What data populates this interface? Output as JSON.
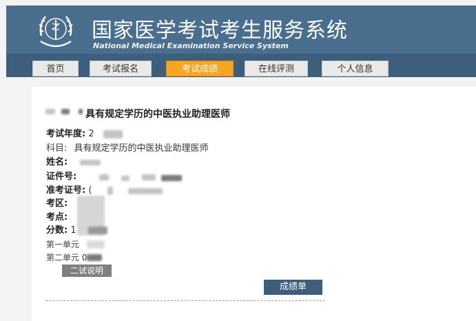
{
  "header": {
    "title_cn": "国家医学考试考生服务系统",
    "title_en": "National Medical Examination Service System"
  },
  "nav": {
    "items": [
      {
        "label": "首页"
      },
      {
        "label": "考试报名"
      },
      {
        "label": "考试成绩"
      },
      {
        "label": "在线评测"
      },
      {
        "label": "个人信息"
      }
    ],
    "active": "考试成绩"
  },
  "result": {
    "title": "具有规定学历的中医执业助理医师",
    "fields": {
      "year": {
        "label": "考试年度:",
        "value": "2"
      },
      "subject": {
        "label": "科目:",
        "value": "具有规定学历的中医执业助理医师"
      },
      "name": {
        "label": "姓名:"
      },
      "id_number": {
        "label": "证件号:"
      },
      "ticket": {
        "label": "准考证号:",
        "value": "("
      },
      "district": {
        "label": "考区:"
      },
      "site": {
        "label": "考点:"
      },
      "score": {
        "label": "分数:",
        "value": "1"
      },
      "unit1": {
        "label": "第一单元"
      },
      "unit2": {
        "label": "第二单元",
        "value": "0"
      }
    },
    "explain_button": "二试说明",
    "report_button": "成绩单"
  },
  "colors": {
    "header_bg": "#4a6e8e",
    "nav_bg": "#3d5e7c",
    "active_tab": "#f6a623"
  }
}
